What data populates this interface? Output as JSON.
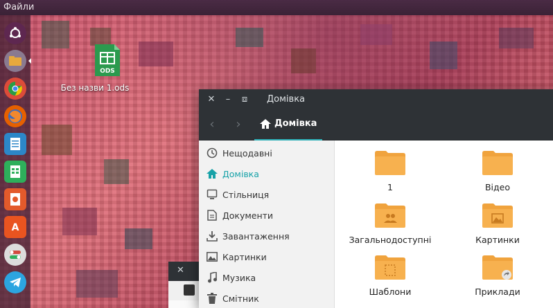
{
  "top_panel": {
    "app_name": "Файли"
  },
  "launcher": {
    "items": [
      {
        "name": "ubuntu-dash",
        "color": "#5e2750"
      },
      {
        "name": "files",
        "color": "#e7a93d"
      },
      {
        "name": "chrome",
        "color": "#dd4b39"
      },
      {
        "name": "firefox",
        "color": "#e66000"
      },
      {
        "name": "writer",
        "color": "#2c87c8"
      },
      {
        "name": "calc",
        "color": "#2eaf5b"
      },
      {
        "name": "impress",
        "color": "#e35a2b"
      },
      {
        "name": "software-center",
        "color": "#e95420"
      },
      {
        "name": "settings",
        "color": "#d24b3f"
      },
      {
        "name": "telegram",
        "color": "#2ca5e0"
      }
    ]
  },
  "desktop": {
    "file_icon_text": "ODS",
    "file_label": "Без назви 1.ods"
  },
  "window": {
    "title": "Домівка",
    "breadcrumb": "Домівка",
    "accent": "#17a2a8",
    "sidebar": [
      {
        "label": "Нещодавні",
        "icon": "clock-icon",
        "active": false
      },
      {
        "label": "Домівка",
        "icon": "home-icon",
        "active": true
      },
      {
        "label": "Стільниця",
        "icon": "desktop-icon",
        "active": false
      },
      {
        "label": "Документи",
        "icon": "document-icon",
        "active": false
      },
      {
        "label": "Завантаження",
        "icon": "download-icon",
        "active": false
      },
      {
        "label": "Картинки",
        "icon": "image-icon",
        "active": false
      },
      {
        "label": "Музика",
        "icon": "music-icon",
        "active": false
      },
      {
        "label": "Смітник",
        "icon": "trash-icon",
        "active": false
      }
    ],
    "folders": [
      {
        "label": "1",
        "emblem": "none"
      },
      {
        "label": "Відео",
        "emblem": "none"
      },
      {
        "label": "Загальнодоступні",
        "emblem": "people"
      },
      {
        "label": "Картинки",
        "emblem": "image"
      },
      {
        "label": "Шаблони",
        "emblem": "template"
      },
      {
        "label": "Приклади",
        "emblem": "link"
      }
    ]
  }
}
